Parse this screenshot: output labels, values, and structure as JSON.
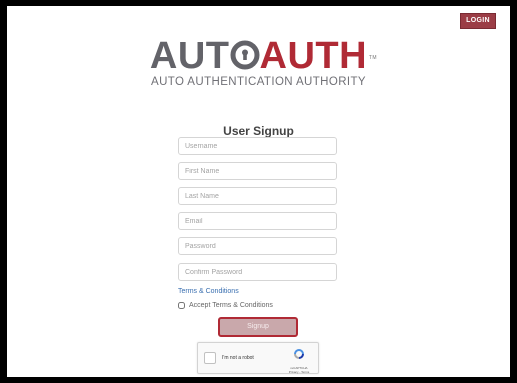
{
  "header": {
    "login_label": "LOGIN"
  },
  "logo": {
    "left": "AUT",
    "right": "AUTH",
    "tm": "TM",
    "tagline": "AUTO AUTHENTICATION AUTHORITY"
  },
  "form": {
    "title": "User Signup",
    "fields": [
      {
        "placeholder": "Username",
        "value": ""
      },
      {
        "placeholder": "First Name",
        "value": ""
      },
      {
        "placeholder": "Last Name",
        "value": ""
      },
      {
        "placeholder": "Email",
        "value": ""
      },
      {
        "placeholder": "Password",
        "value": ""
      },
      {
        "placeholder": "Confirm Password",
        "value": ""
      }
    ],
    "terms_link": "Terms & Conditions",
    "accept_label": "Accept Terms & Conditions",
    "submit_label": "Signup"
  },
  "captcha": {
    "label": "I'm not a robot",
    "brand": "reCAPTCHA",
    "links": "Privacy - Terms"
  },
  "colors": {
    "brand_red": "#b02a35",
    "logo_grey": "#636369",
    "link_blue": "#3a6fb0"
  },
  "icons": [
    "lock-keyhole-icon",
    "recaptcha-icon",
    "checkbox-icon"
  ]
}
